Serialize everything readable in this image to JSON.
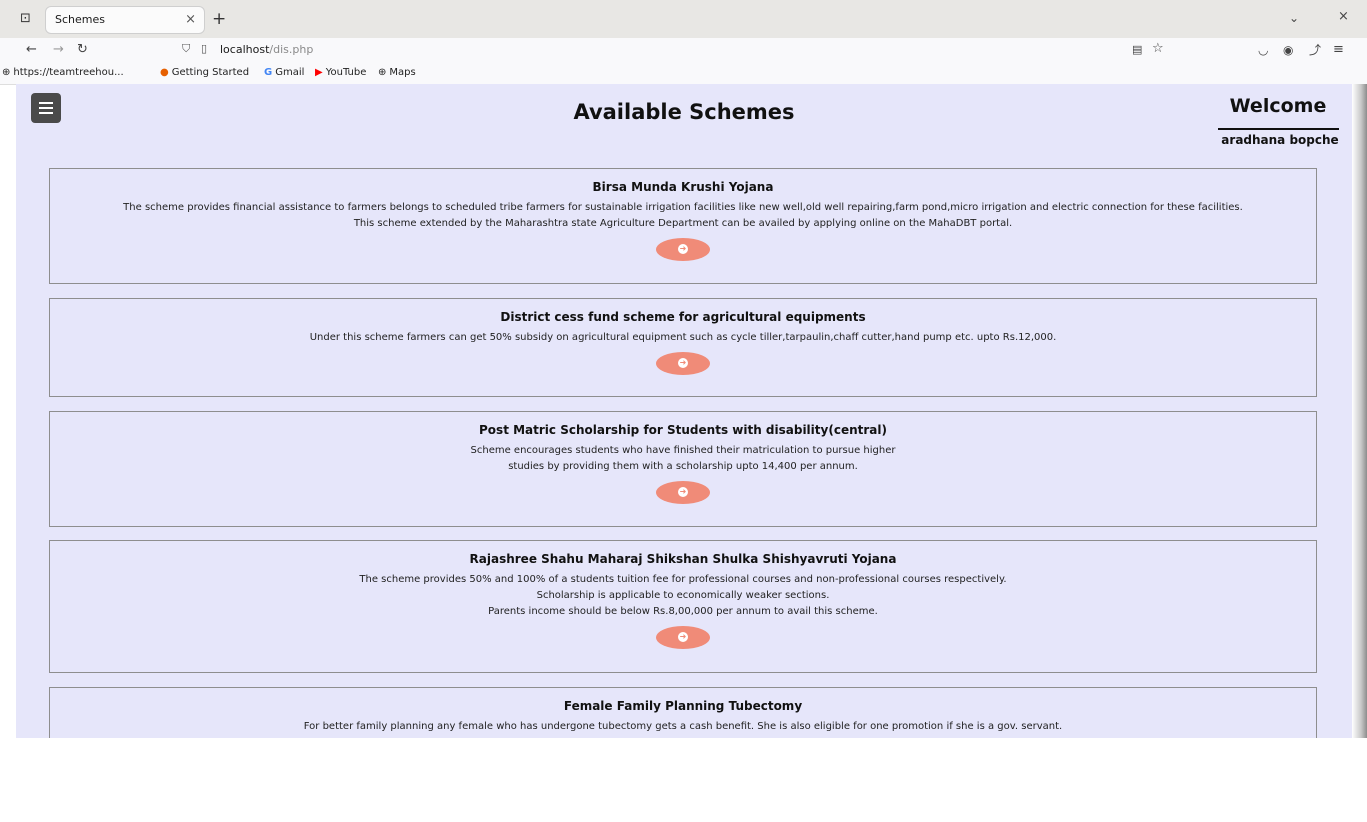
{
  "browser": {
    "tab_list_icon": "tab-list-icon",
    "tab_title": "Schemes",
    "tab_close": "×",
    "new_tab": "+",
    "window_menu": "⌄",
    "window_close": "×",
    "url_host": "localhost",
    "url_path": "/dis.php",
    "bookmarks": [
      {
        "icon": "globe-icon",
        "label": "https://teamtreehou..."
      },
      {
        "icon": "firefox-icon",
        "label": "Getting Started"
      },
      {
        "icon": "google-icon",
        "label": "Gmail"
      },
      {
        "icon": "youtube-icon",
        "label": "YouTube"
      },
      {
        "icon": "globe-icon",
        "label": "Maps"
      }
    ]
  },
  "header": {
    "title": "Available Schemes",
    "welcome": "Welcome",
    "username": "aradhana bopche"
  },
  "schemes": [
    {
      "title": "Birsa Munda Krushi Yojana",
      "lines": [
        "The scheme provides financial assistance to farmers belongs to scheduled tribe farmers for sustainable irrigation facilities like new well,old well repairing,farm pond,micro irrigation and electric connection for these facilities.",
        "This scheme extended by the Maharashtra state Agriculture Department can be availed by applying online on the MahaDBT portal."
      ]
    },
    {
      "title": "District cess fund scheme for agricultural equipments",
      "lines": [
        "Under this scheme farmers can get 50% subsidy on agricultural equipment such as cycle tiller,tarpaulin,chaff cutter,hand pump etc. upto Rs.12,000."
      ]
    },
    {
      "title": "Post Matric Scholarship for Students with disability(central)",
      "lines": [
        "Scheme encourages students who have finished their matriculation to pursue higher",
        "studies by providing them with a scholarship upto 14,400 per annum."
      ]
    },
    {
      "title": "Rajashree Shahu Maharaj Shikshan Shulka Shishyavruti Yojana",
      "lines": [
        "The scheme provides 50% and 100% of a students tuition fee for professional courses and non-professional courses respectively.",
        "Scholarship is applicable to economically weaker sections.",
        "Parents income should be below Rs.8,00,000 per annum to avail this scheme."
      ]
    },
    {
      "title": "Female Family Planning Tubectomy",
      "lines": [
        "For better family planning any female who has undergone tubectomy gets a cash benefit. She is also eligible for one promotion if she is a gov. servant."
      ]
    }
  ]
}
